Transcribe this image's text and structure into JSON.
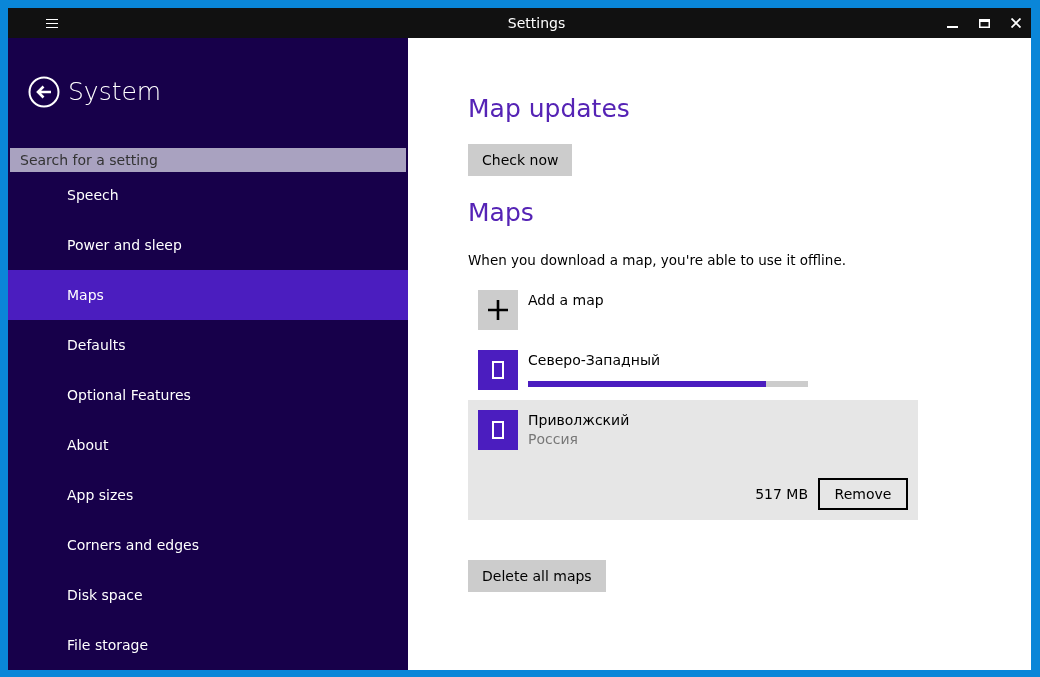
{
  "window": {
    "title": "Settings"
  },
  "sidebar": {
    "title": "System",
    "search": {
      "placeholder": "Search for a setting"
    },
    "items": [
      {
        "label": "Speech",
        "selected": false
      },
      {
        "label": "Power and sleep",
        "selected": false
      },
      {
        "label": "Maps",
        "selected": true
      },
      {
        "label": "Defaults",
        "selected": false
      },
      {
        "label": "Optional Features",
        "selected": false
      },
      {
        "label": "About",
        "selected": false
      },
      {
        "label": "App sizes",
        "selected": false
      },
      {
        "label": "Corners and edges",
        "selected": false
      },
      {
        "label": "Disk space",
        "selected": false
      },
      {
        "label": "File storage",
        "selected": false
      }
    ]
  },
  "content": {
    "updates_heading": "Map updates",
    "check_button": "Check now",
    "maps_heading": "Maps",
    "description": "When you download a map, you're able to use it offline.",
    "maps": [
      {
        "kind": "add",
        "name": "Add a map",
        "selected": false
      },
      {
        "kind": "downloading",
        "name": "Северо-Западный",
        "level": 0.85,
        "selected": false
      },
      {
        "kind": "installed",
        "name": "Приволжский",
        "region": "Россия",
        "size": "517 MB",
        "action": "Remove",
        "selected": true
      }
    ],
    "delete_button": "Delete all maps"
  }
}
